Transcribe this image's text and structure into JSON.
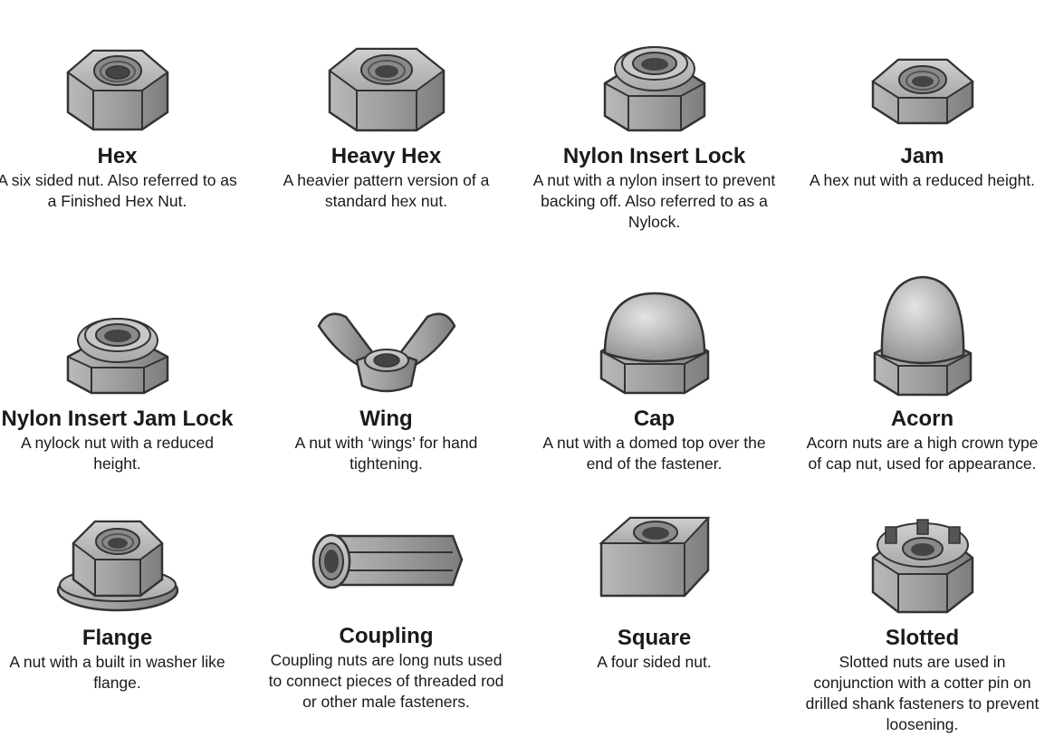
{
  "nuts": [
    {
      "icon": "hex-nut-icon",
      "name": "Hex",
      "desc": "A six sided nut.  Also referred to as a Finished Hex Nut."
    },
    {
      "icon": "heavy-hex-nut-icon",
      "name": "Heavy Hex",
      "desc": "A heavier pattern version of a standard hex nut."
    },
    {
      "icon": "nylon-insert-lock-nut-icon",
      "name": "Nylon Insert Lock",
      "desc": "A nut with a nylon insert to prevent backing off. Also referred to as a Nylock."
    },
    {
      "icon": "jam-nut-icon",
      "name": "Jam",
      "desc": "A hex nut with a reduced height."
    },
    {
      "icon": "nylon-insert-jam-lock-nut-icon",
      "name": "Nylon Insert Jam Lock",
      "desc": "A nylock nut with a reduced height."
    },
    {
      "icon": "wing-nut-icon",
      "name": "Wing",
      "desc": "A nut with ‘wings’ for hand tightening."
    },
    {
      "icon": "cap-nut-icon",
      "name": "Cap",
      "desc": "A nut with a domed top over the end of the fastener."
    },
    {
      "icon": "acorn-nut-icon",
      "name": "Acorn",
      "desc": "Acorn nuts are a high crown type of cap nut, used for appearance."
    },
    {
      "icon": "flange-nut-icon",
      "name": "Flange",
      "desc": "A nut with a built in washer like flange."
    },
    {
      "icon": "coupling-nut-icon",
      "name": "Coupling",
      "desc": "Coupling nuts are long nuts used to connect pieces of threaded rod or other male fasteners."
    },
    {
      "icon": "square-nut-icon",
      "name": "Square",
      "desc": "A four sided nut."
    },
    {
      "icon": "slotted-nut-icon",
      "name": "Slotted",
      "desc": "Slotted nuts are used in conjunction with a cotter pin on drilled shank fasteners to prevent loosening."
    }
  ]
}
